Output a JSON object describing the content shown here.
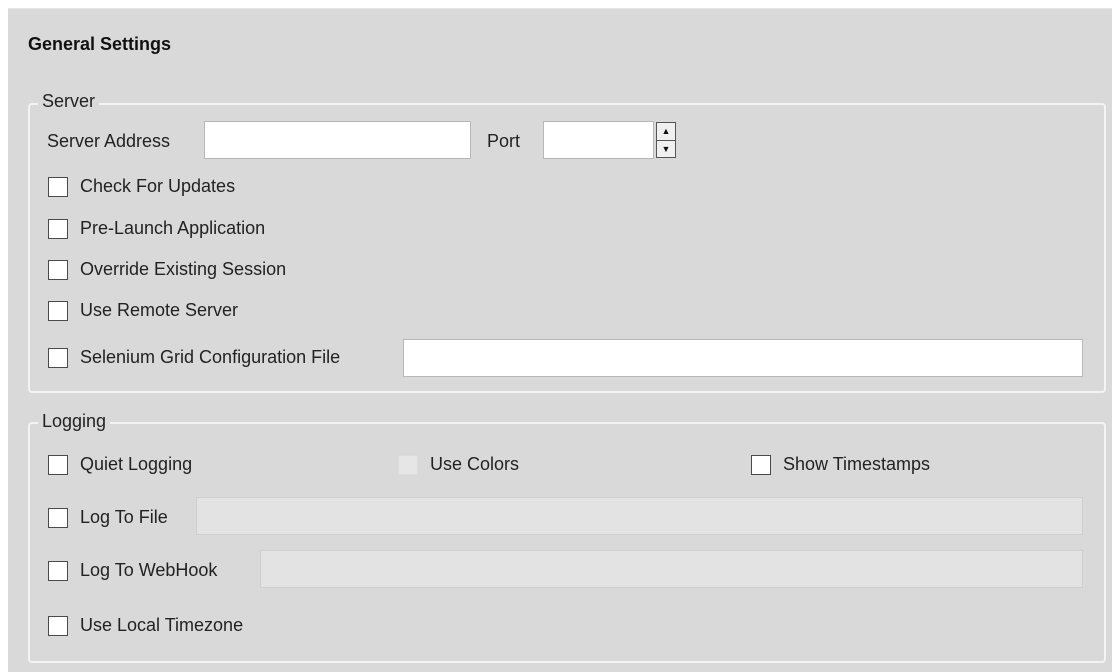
{
  "title": "General Settings",
  "server": {
    "legend": "Server",
    "address_label": "Server Address",
    "address_value": "",
    "port_label": "Port",
    "port_value": "",
    "check_for_updates": "Check For Updates",
    "pre_launch": "Pre-Launch Application",
    "override_session": "Override Existing Session",
    "use_remote": "Use Remote Server",
    "grid_config": "Selenium Grid Configuration File",
    "grid_config_value": ""
  },
  "logging": {
    "legend": "Logging",
    "quiet": "Quiet Logging",
    "use_colors": "Use Colors",
    "show_timestamps": "Show Timestamps",
    "log_to_file": "Log To File",
    "log_to_file_value": "",
    "log_to_webhook": "Log To WebHook",
    "log_to_webhook_value": "",
    "use_local_timezone": "Use Local Timezone"
  },
  "icons": {
    "spin_up": "triangle-up-icon",
    "spin_down": "triangle-down-icon"
  }
}
